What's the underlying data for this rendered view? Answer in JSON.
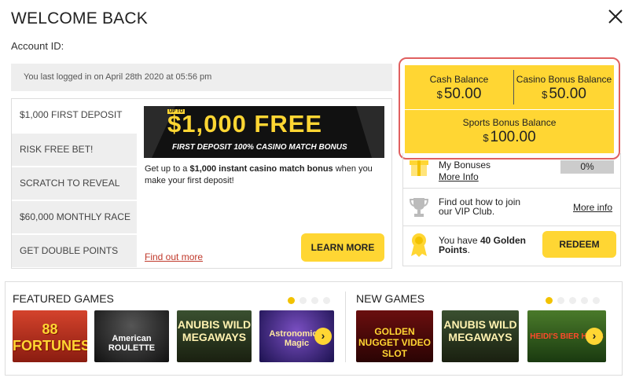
{
  "header": {
    "title": "WELCOME BACK",
    "account_label": "Account ID:"
  },
  "last_login": "You last logged in on April 28th 2020 at 05:56 pm",
  "balances": {
    "currency": "$",
    "cash_label": "Cash Balance",
    "cash_amount": "50.00",
    "casino_label": "Casino Bonus Balance",
    "casino_amount": "50.00",
    "sports_label": "Sports Bonus Balance",
    "sports_amount": "100.00"
  },
  "promotions": {
    "tabs": [
      {
        "label": "$1,000 FIRST DEPOSIT",
        "active": true
      },
      {
        "label": "RISK FREE BET!",
        "active": false
      },
      {
        "label": "SCRATCH TO REVEAL",
        "active": false
      },
      {
        "label": "$60,000 MONTHLY RACE",
        "active": false
      },
      {
        "label": "GET DOUBLE POINTS",
        "active": false
      }
    ],
    "banner_badge": "UP TO",
    "banner_headline": "$1,000 FREE",
    "banner_subline": "FIRST DEPOSIT 100% CASINO MATCH BONUS",
    "text_before": "Get up to a ",
    "text_bold": "$1,000 instant casino match bonus",
    "text_after": " when you make your first deposit!",
    "find_out_more": "Find out more",
    "learn_more": "LEARN MORE"
  },
  "side": {
    "bonuses_label": "My Bonuses",
    "bonuses_more": "More Info",
    "bonuses_progress": "0%",
    "bonuses_progress_value": 0,
    "vip_text": "Find out how to join our VIP Club.",
    "vip_more": "More info",
    "golden_before": "You have ",
    "golden_bold": "40 Golden",
    "golden_bold2": "Points",
    "golden_after": ".",
    "redeem": "REDEEM"
  },
  "featured": {
    "title": "FEATURED GAMES",
    "dots": 4,
    "active_dot": 0,
    "games": [
      {
        "name": "88 FORTUNES"
      },
      {
        "name": "American ROULETTE"
      },
      {
        "name": "ANUBIS WILD MEGAWAYS"
      },
      {
        "name": "Astronomical Magic"
      }
    ]
  },
  "new_games": {
    "title": "NEW GAMES",
    "dots": 5,
    "active_dot": 0,
    "games": [
      {
        "name": "GOLDEN NUGGET VIDEO SLOT"
      },
      {
        "name": "ANUBIS WILD MEGAWAYS"
      },
      {
        "name": "HEIDI'S BIER HAUS"
      }
    ]
  },
  "colors": {
    "accent": "#ffd633",
    "highlight_border": "#e06060",
    "link": "#c0392b"
  }
}
